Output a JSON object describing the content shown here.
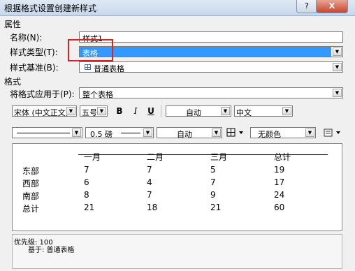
{
  "window": {
    "title": "根据格式设置创建新样式",
    "help_label": "?",
    "close_label": "X"
  },
  "properties": {
    "section_label": "属性",
    "name_label": "名称(N):",
    "name_value": "样式1",
    "type_label": "样式类型(T):",
    "type_value": "表格",
    "based_on_label": "样式基准(B):",
    "based_on_value": "普通表格"
  },
  "format": {
    "section_label": "格式",
    "apply_to_label": "将格式应用于(P):",
    "apply_to_value": "整个表格",
    "font": "宋体 (中文正文)",
    "size": "五号",
    "bold": "B",
    "italic": "I",
    "underline": "U",
    "font_color": "自动",
    "script": "中文",
    "border_weight": "0.5 磅",
    "border_color": "自动",
    "shading": "无颜色"
  },
  "preview": {
    "headers": [
      "一月",
      "二月",
      "三月",
      "总计"
    ],
    "rows": [
      {
        "label": "东部",
        "values": [
          "7",
          "7",
          "5",
          "19"
        ]
      },
      {
        "label": "西部",
        "values": [
          "6",
          "4",
          "7",
          "17"
        ]
      },
      {
        "label": "南部",
        "values": [
          "8",
          "7",
          "9",
          "24"
        ]
      },
      {
        "label": "总计",
        "values": [
          "21",
          "18",
          "21",
          "60"
        ]
      }
    ]
  },
  "description": {
    "line1": "优先级: 100",
    "line2": "基于: 普通表格"
  }
}
